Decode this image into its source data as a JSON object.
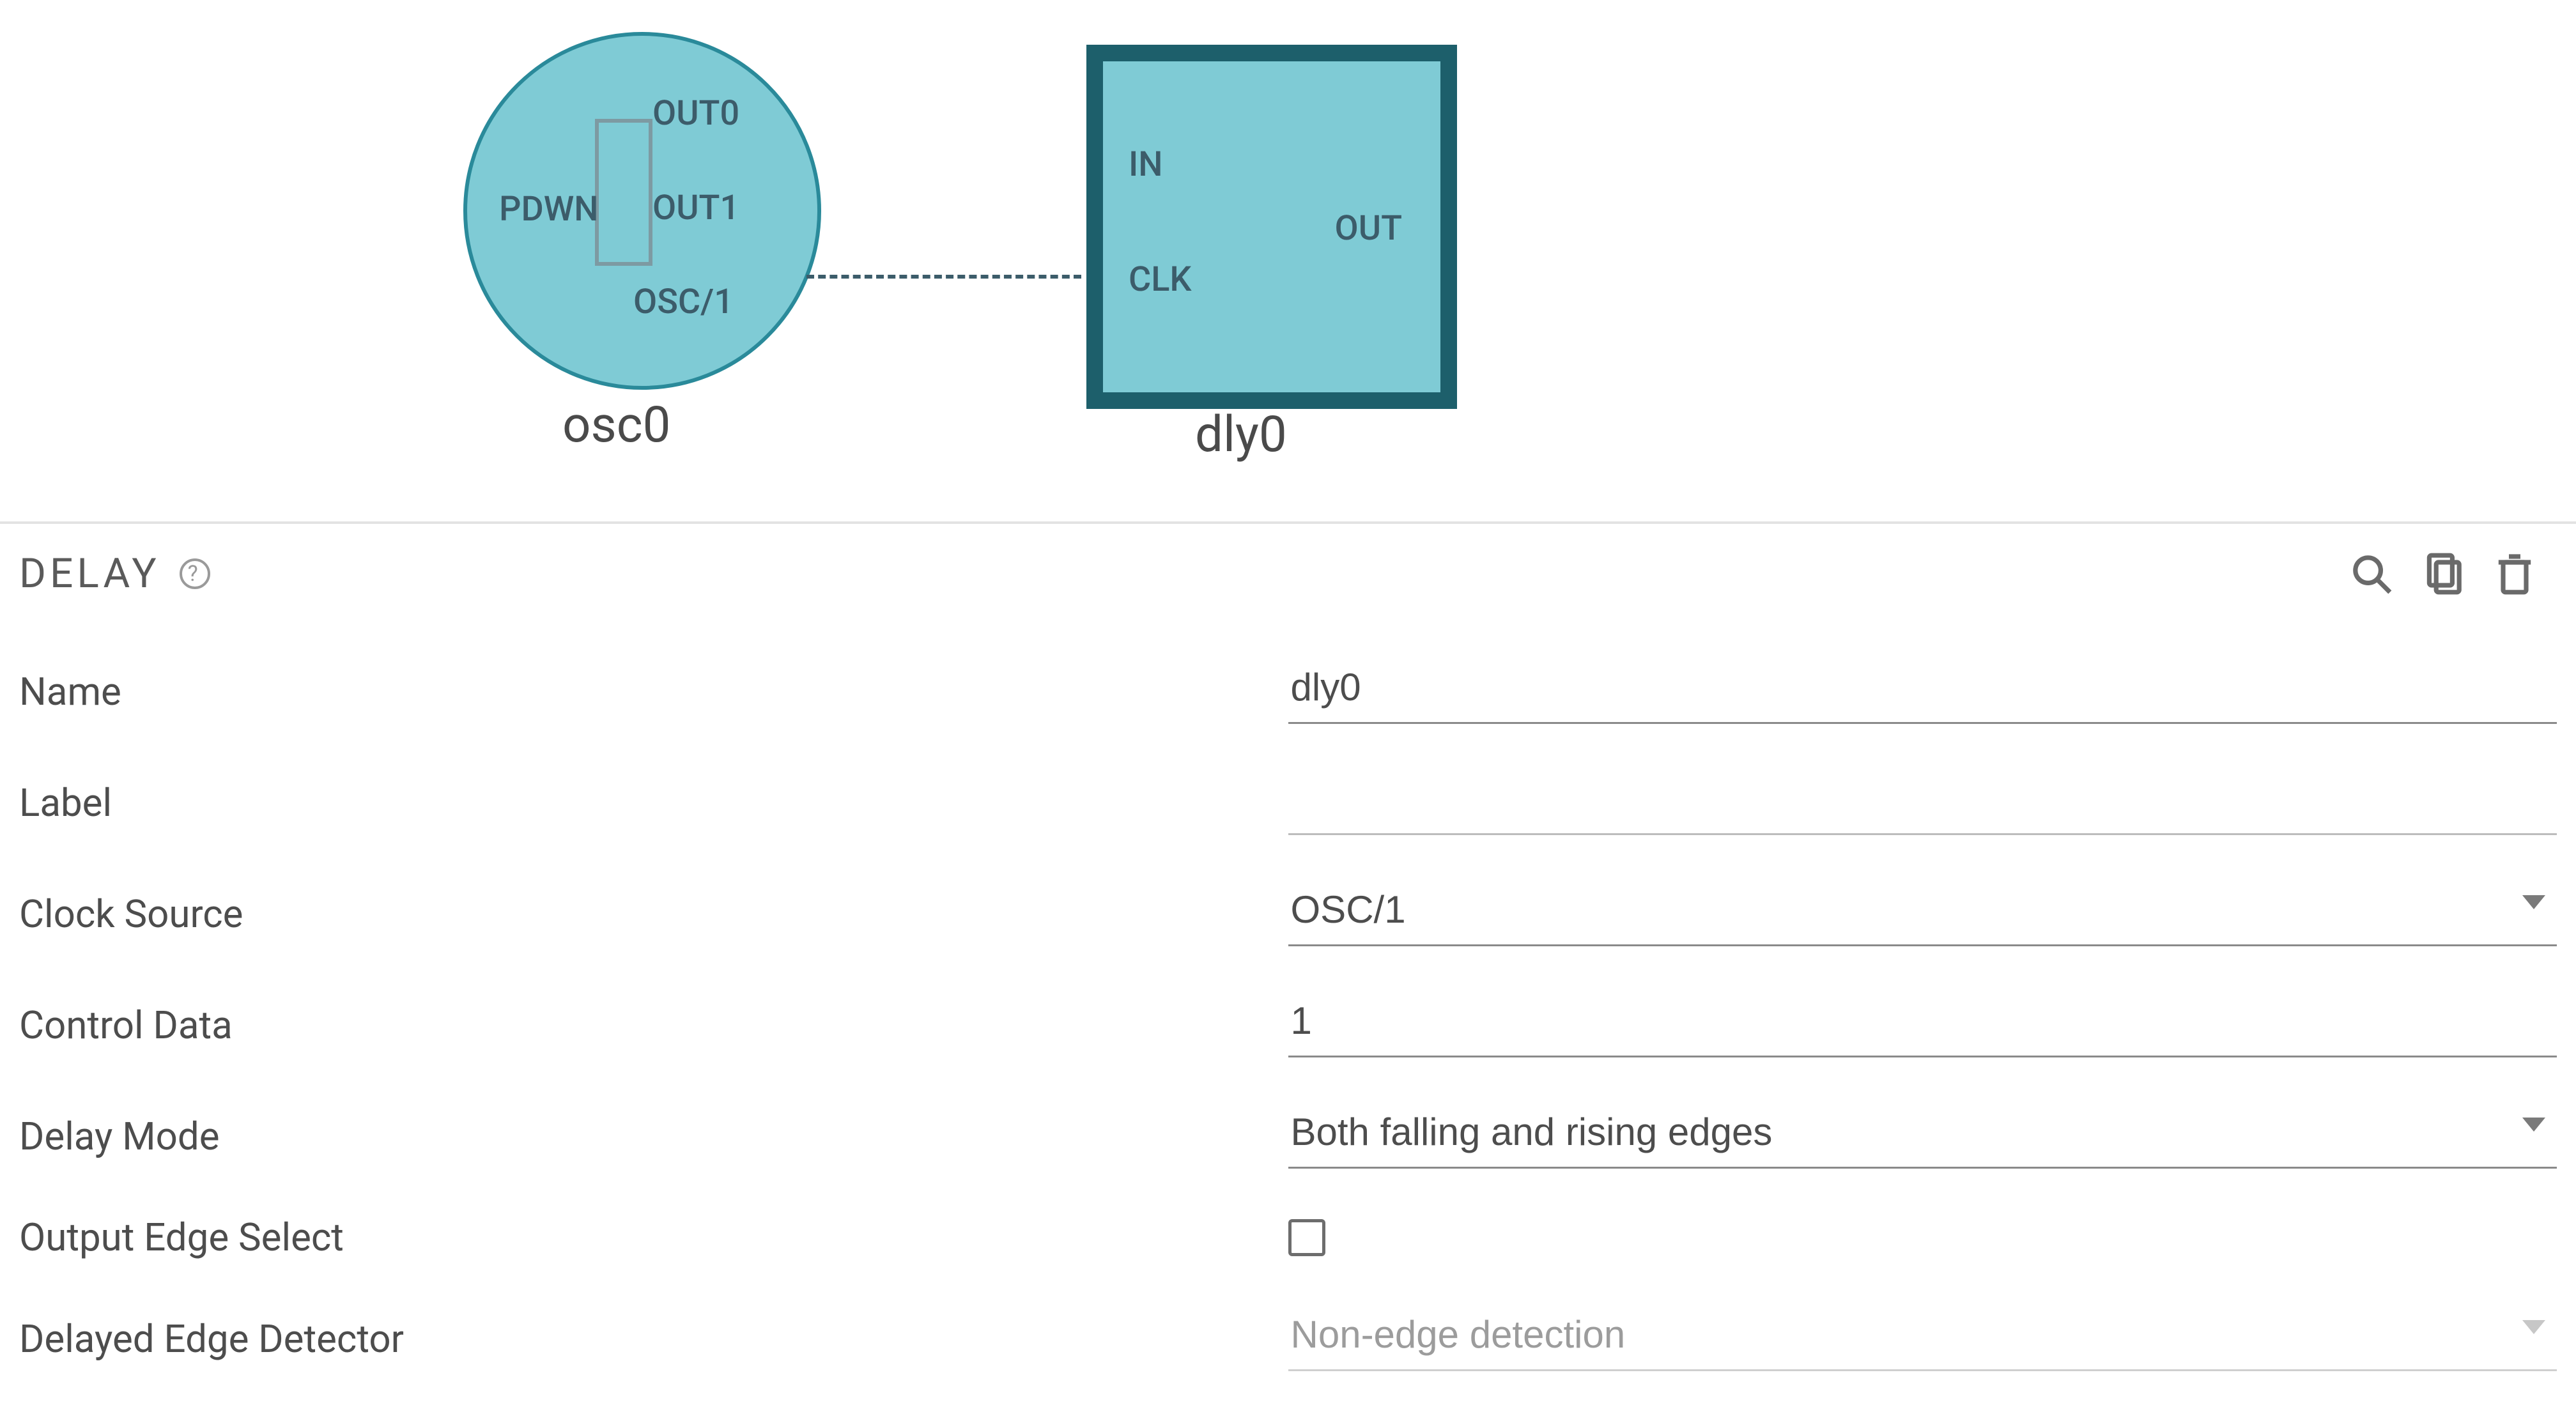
{
  "canvas": {
    "nodes": {
      "osc": {
        "label": "osc0",
        "pins": {
          "pdwn": "PDWN",
          "out0": "OUT0",
          "out1": "OUT1",
          "oscdiv": "OSC/1"
        }
      },
      "dly": {
        "label": "dly0",
        "pins": {
          "in": "IN",
          "clk": "CLK",
          "out": "OUT"
        }
      }
    }
  },
  "properties": {
    "title": "DELAY",
    "fields": {
      "name": {
        "label": "Name",
        "value": "dly0"
      },
      "label": {
        "label": "Label",
        "value": ""
      },
      "clock_source": {
        "label": "Clock Source",
        "value": "OSC/1"
      },
      "control_data": {
        "label": "Control Data",
        "value": "1"
      },
      "delay_mode": {
        "label": "Delay Mode",
        "value": "Both falling and rising edges"
      },
      "output_edge_select": {
        "label": "Output Edge Select",
        "checked": false
      },
      "delayed_edge_detector": {
        "label": "Delayed Edge Detector",
        "value": "Non-edge detection"
      }
    }
  }
}
